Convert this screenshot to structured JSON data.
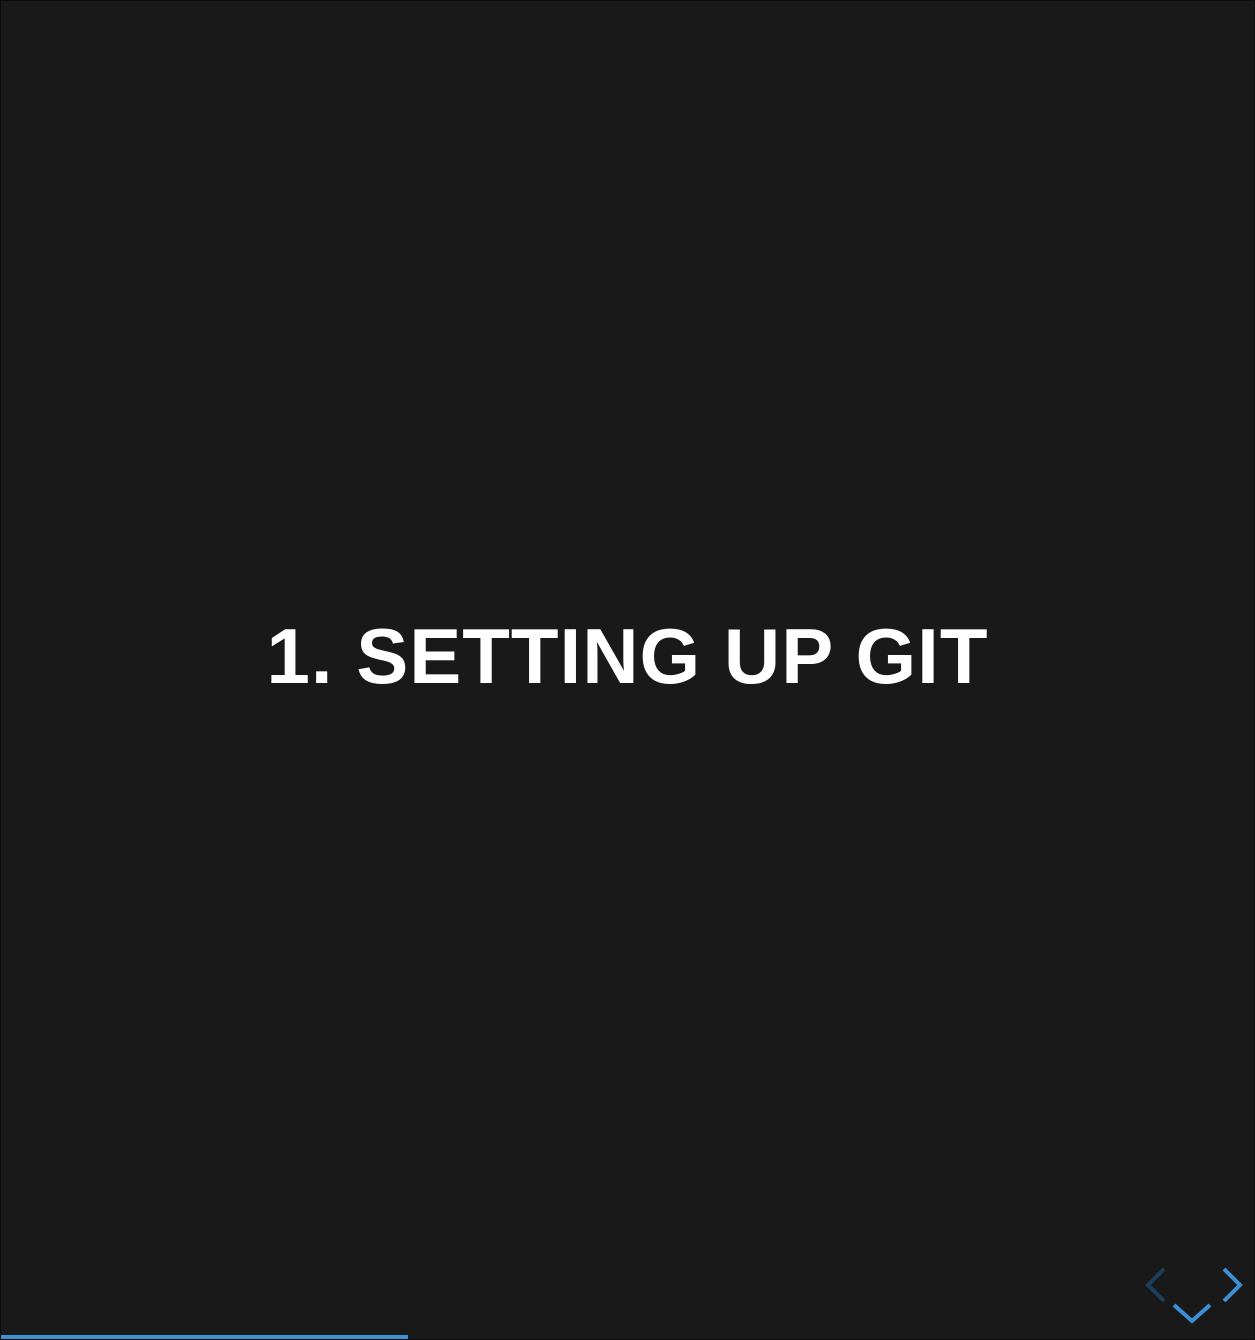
{
  "slide": {
    "title": "1. SETTING UP GIT"
  },
  "navigation": {
    "prev_icon": "chevron-left-icon",
    "next_icon": "chevron-right-icon",
    "down_icon": "chevron-down-icon",
    "enabled_color": "#3d8fd6",
    "disabled_color": "#1c3f5e"
  },
  "progress": {
    "fraction": 0.325,
    "color": "#3d8fd6"
  },
  "colors": {
    "background": "#191919",
    "text": "#ffffff"
  }
}
